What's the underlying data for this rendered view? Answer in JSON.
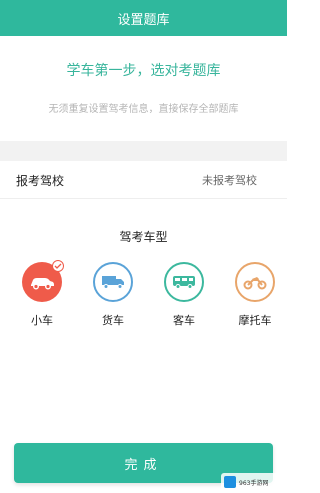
{
  "header": {
    "title": "设置题库"
  },
  "intro": {
    "headline": "学车第一步，选对考题库",
    "subtext": "无须重复设置驾考信息，直接保存全部题库"
  },
  "school": {
    "label": "报考驾校",
    "value": "未报考驾校"
  },
  "vehicle_section": {
    "title": "驾考车型",
    "items": [
      {
        "label": "小车",
        "icon": "car-icon",
        "selected": true
      },
      {
        "label": "货车",
        "icon": "truck-icon",
        "selected": false
      },
      {
        "label": "客车",
        "icon": "bus-icon",
        "selected": false
      },
      {
        "label": "摩托车",
        "icon": "motorcycle-icon",
        "selected": false
      }
    ]
  },
  "footer": {
    "done_label": "完成"
  },
  "watermark": {
    "text": "963手游网"
  },
  "colors": {
    "accent": "#2fb89d",
    "car": "#ef5b4a",
    "truck": "#5aa3d8",
    "bus": "#3cb89e",
    "moto": "#e8a56a"
  }
}
